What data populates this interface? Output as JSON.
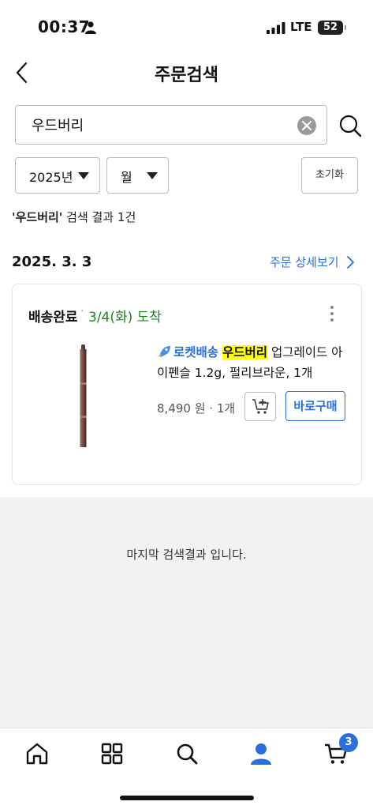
{
  "status_bar": {
    "time": "00:37",
    "network": "LTE",
    "battery": "52"
  },
  "header": {
    "title": "주문검색"
  },
  "search": {
    "value": "우드버리"
  },
  "filters": {
    "year": "2025년",
    "month": "월",
    "reset_label": "초기화"
  },
  "summary": {
    "query": "'우드버리'",
    "text": " 검색 결과 1건"
  },
  "order": {
    "date": "2025. 3. 3",
    "detail_link": "주문 상세보기",
    "status": "배송완료",
    "dot": "·",
    "arrival": "3/4(화) 도착",
    "product": {
      "delivery_label": "로켓배송",
      "brand": "우드버리",
      "name": " 업그레이드 아이펜슬 1.2g, 펄리브라운, 1개",
      "price": "8,490 원 · 1개"
    },
    "buy_now_label": "바로구매"
  },
  "end_message": "마지막 검색결과 입니다.",
  "tab_bar": {
    "cart_count": "3"
  },
  "colors": {
    "accent": "#2a6fe0",
    "arrival_green": "#1b8a1b",
    "highlight": "#ffff00"
  }
}
